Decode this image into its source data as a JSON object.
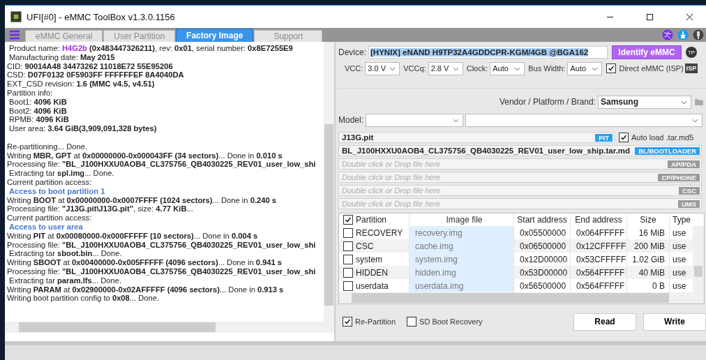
{
  "window": {
    "title": "UFI[#0] - eMMC ToolBox v1.3.0.1156"
  },
  "tabs": [
    {
      "label": "eMMC General",
      "selected": false
    },
    {
      "label": "User Partition",
      "selected": false
    },
    {
      "label": "Factory Image",
      "selected": true
    },
    {
      "label": "Support",
      "selected": false
    }
  ],
  "log": [
    {
      "kind": "product",
      "text": "Product name: **H4G2b** **(0x483447326211)**, rev: **0x01**, serial number: **0x8E7255E9**"
    },
    {
      "kind": "sub",
      "text": "Manufacturing date: **May 2015**"
    },
    {
      "kind": "log",
      "text": "CID: **90014A48 34473262 11018E72 55E95206**"
    },
    {
      "kind": "log",
      "text": "CSD: **D07F0132 0F5903FF FFFFFFEF 8A4040DA**"
    },
    {
      "kind": "log",
      "text": "EXT_CSD revision: **1.6 (MMC v4.5, v4.51)**"
    },
    {
      "kind": "log",
      "text": "Partition info:"
    },
    {
      "kind": "sub",
      "text": "Boot1: **4096 KiB**"
    },
    {
      "kind": "sub",
      "text": "Boot2: **4096 KiB**"
    },
    {
      "kind": "sub",
      "text": "RPMB: **4096 KiB**"
    },
    {
      "kind": "sub",
      "text": "User area: **3.64 GiB(3,909,091,328 bytes)**"
    },
    {
      "kind": "gap"
    },
    {
      "kind": "log",
      "text": "Re-partitioning... Done."
    },
    {
      "kind": "log",
      "text": "Writing **MBR, GPT** at **0x00000000-0x000043FF (34 sectors)**... Done in **0.010 s**"
    },
    {
      "kind": "log",
      "text": "Processing file: **\"BL_J100HXXU0AOB4_CL375756_QB4030225_REV01_user_low_shi**"
    },
    {
      "kind": "sub",
      "text": "Extracting tar **spl.img**... Done."
    },
    {
      "kind": "log",
      "text": "Current partition access:"
    },
    {
      "kind": "heading",
      "text": "Access to boot partition 1"
    },
    {
      "kind": "log",
      "text": "Writing **BOOT** at **0x00000000-0x0007FFFF (1024 sectors)**... Done in **0.240 s**"
    },
    {
      "kind": "log",
      "text": "Processing file: **\"J13G.pit\\J13G.pit\"**, size: **4.77 KiB**..."
    },
    {
      "kind": "log",
      "text": "Current partition access:"
    },
    {
      "kind": "heading",
      "text": "Access to user area"
    },
    {
      "kind": "log",
      "text": "Writing **PIT** at **0x00080000-0x000FFFFF (10 sectors)**... Done in **0.004 s**"
    },
    {
      "kind": "log",
      "text": "Processing file: **\"BL_J100HXXU0AOB4_CL375756_QB4030225_REV01_user_low_shi**"
    },
    {
      "kind": "sub",
      "text": "Extracting tar **sboot.bin**... Done."
    },
    {
      "kind": "log",
      "text": "Writing **SBOOT** at **0x00400000-0x005FFFFF (4096 sectors)**... Done in **0.941 s**"
    },
    {
      "kind": "log",
      "text": "Processing file: **\"BL_J100HXXU0AOB4_CL375756_QB4030225_REV01_user_low_shi**"
    },
    {
      "kind": "sub",
      "text": "Extracting tar **param.lfs**... Done."
    },
    {
      "kind": "log",
      "text": "Writing **PARAM** at **0x02900000-0x02AFFFFF (4096 sectors)**... Done in **0.913 s**"
    },
    {
      "kind": "log",
      "text": "Writing boot partition config to **0x08**... Done."
    }
  ],
  "device": {
    "label": "Device:",
    "value": "[HYNIX] eNAND H9TP32A4GDDCPR-KGM/4GB  @BGA162",
    "identify_button": "Identify eMMC",
    "tp_badge": "TP"
  },
  "power": [
    {
      "label": "VCC:",
      "value": "3.0 V"
    },
    {
      "label": "VCCq:",
      "value": "2.8 V"
    },
    {
      "label": "Clock:",
      "value": "Auto"
    },
    {
      "label": "Bus Width:",
      "value": "Auto"
    }
  ],
  "direct_emmc": {
    "label": "Direct eMMC (ISP)",
    "checked": true,
    "badge": "ISP"
  },
  "vendor": {
    "label": "Vendor / Platform / Brand:",
    "value": "Samsung"
  },
  "model": {
    "label": "Model:"
  },
  "files": [
    {
      "value": "J13G.pit",
      "badge": "PIT",
      "loaded": true
    },
    {
      "value": "BL_J100HXXU0AOB4_CL375756_QB4030225_REV01_user_low_ship.tar.md",
      "badge": "BL/BOOTLOADER",
      "loaded": true
    },
    {
      "placeholder": "Double click or Drop file here",
      "badge": "AP/PDA",
      "loaded": false
    },
    {
      "placeholder": "Double click or Drop file here",
      "badge": "CP/PHONE",
      "loaded": false
    },
    {
      "placeholder": "Double click or Drop file here",
      "badge": "CSC",
      "loaded": false
    },
    {
      "placeholder": "Double click or Drop file here",
      "badge": "UMS",
      "loaded": false
    }
  ],
  "auto_load": {
    "label": "Auto load .tar.md5",
    "checked": true
  },
  "table": {
    "all_checked": true,
    "columns": [
      "Partition",
      "Image file",
      "Start address",
      "End address",
      "Size",
      "Type"
    ],
    "rows": [
      {
        "checked": false,
        "cells": [
          "RECOVERY",
          "recovery.img",
          "0x05500000",
          "0x064FFFFF",
          "16 MiB",
          "use"
        ]
      },
      {
        "checked": false,
        "cells": [
          "CSC",
          "cache.img",
          "0x06500000",
          "0x12CFFFFF",
          "200 MiB",
          "use"
        ]
      },
      {
        "checked": false,
        "cells": [
          "system",
          "system.img",
          "0x12D00000",
          "0x53CFFFFF",
          "1.02 GiB",
          "use"
        ]
      },
      {
        "checked": false,
        "cells": [
          "HIDDEN",
          "hidden.img",
          "0x53D00000",
          "0x564FFFFF",
          "40 MiB",
          "use"
        ]
      },
      {
        "checked": false,
        "cells": [
          "userdata",
          "userdata.img",
          "0x56500000",
          "0x564FFFFF",
          "0 B",
          "use"
        ]
      }
    ]
  },
  "options": [
    {
      "label": "Re-Partition",
      "checked": true
    },
    {
      "label": "SD Boot Recovery",
      "checked": false
    }
  ],
  "buttons": [
    "Read",
    "Write"
  ]
}
